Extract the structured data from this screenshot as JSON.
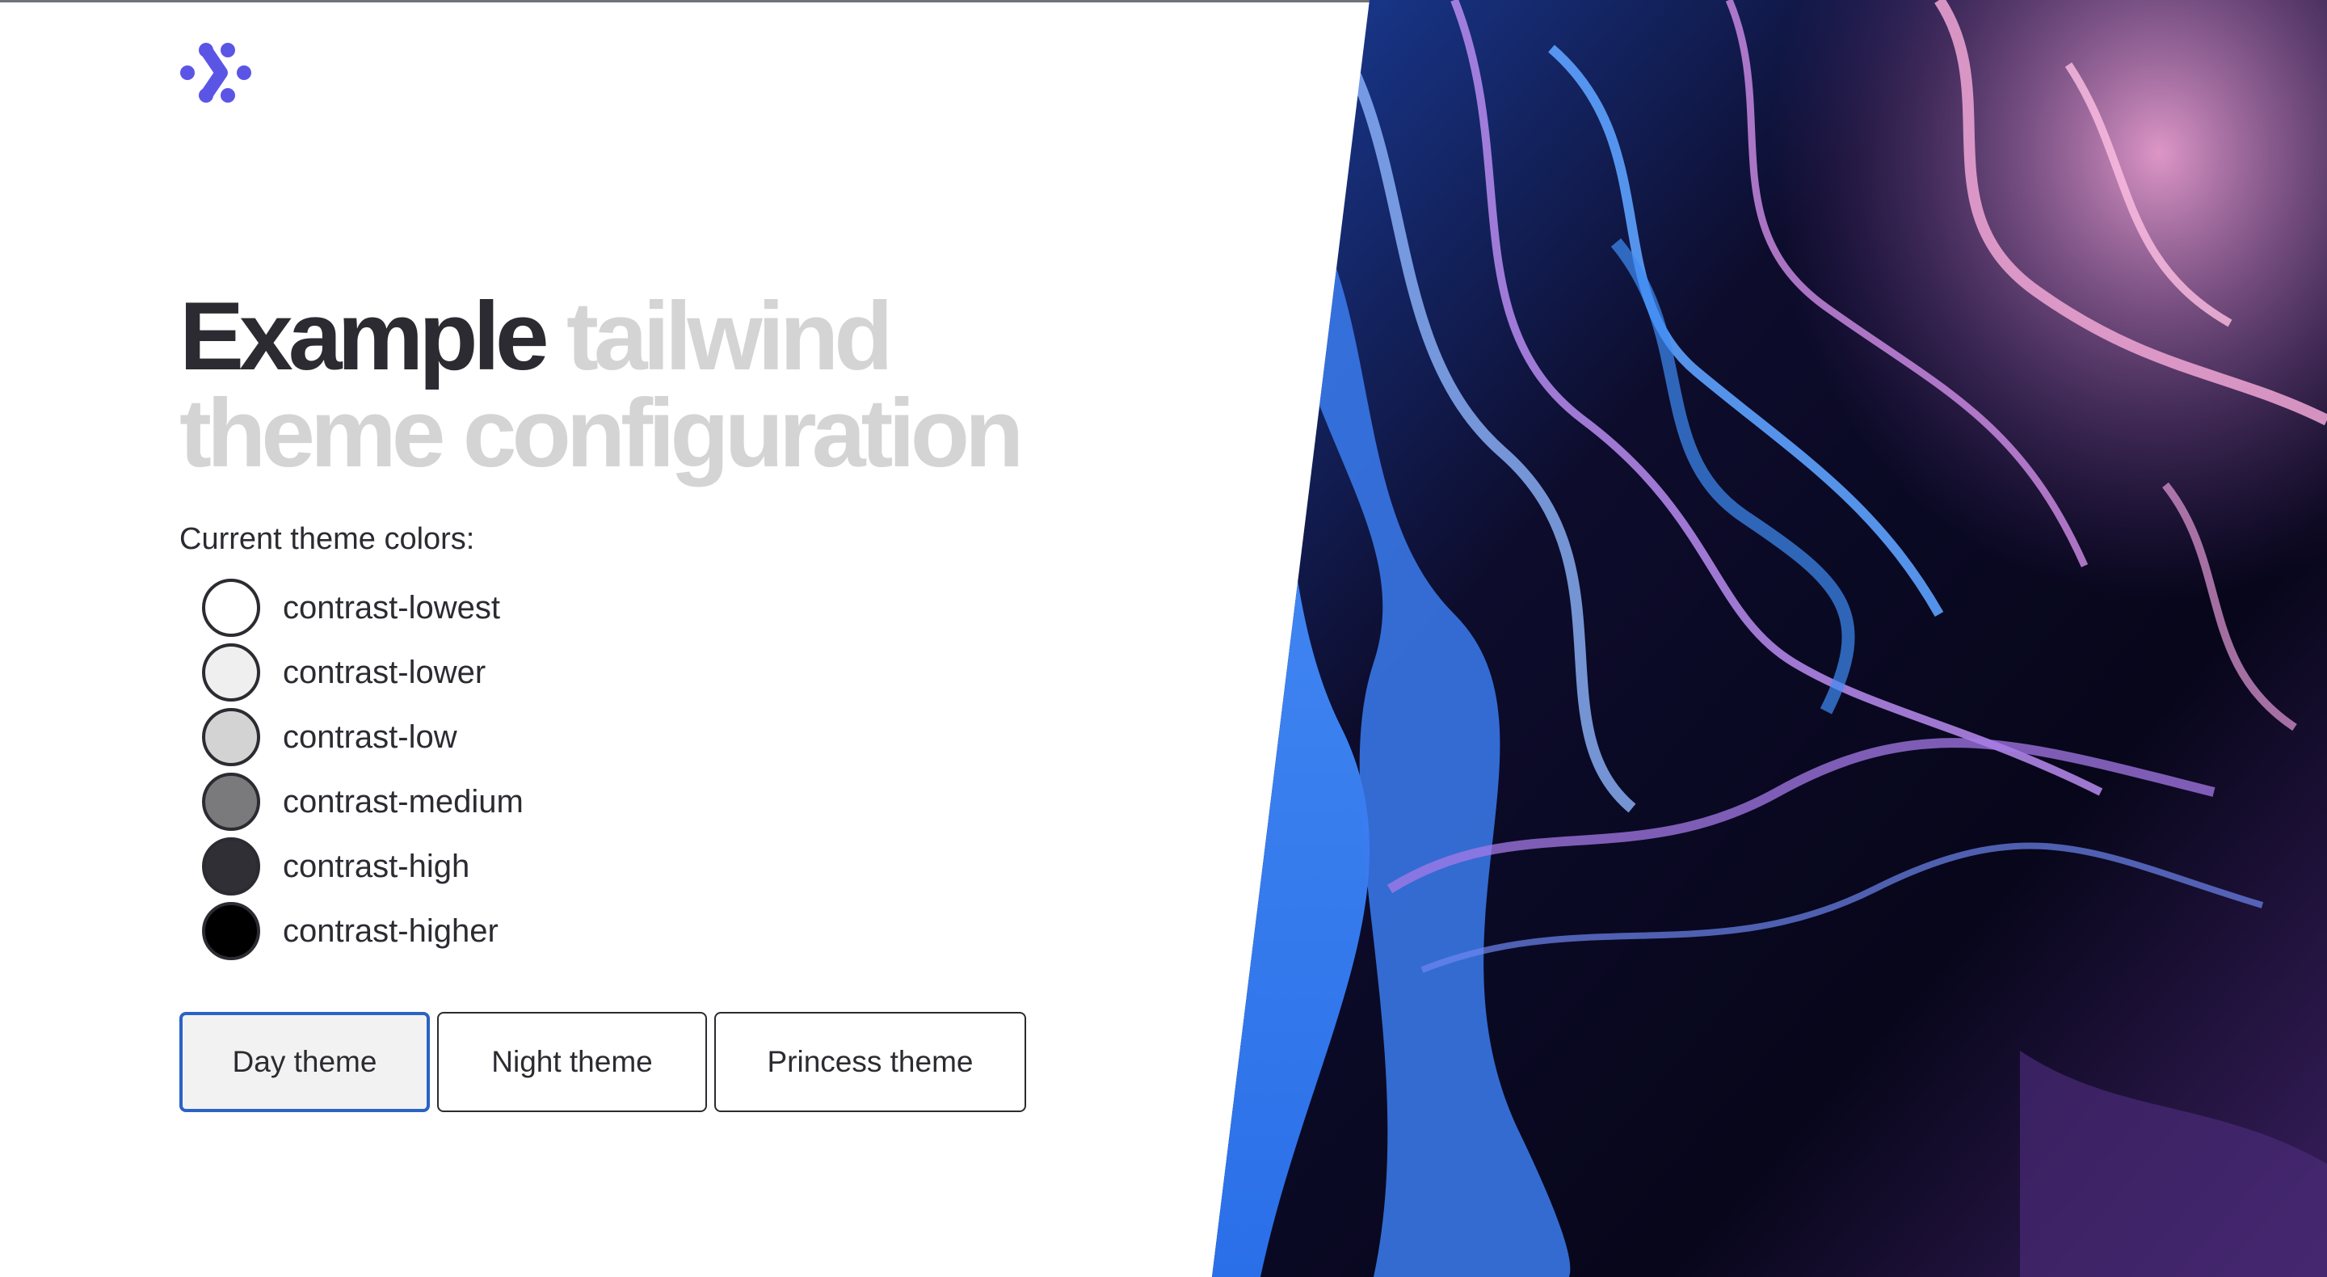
{
  "brand": {
    "logo_icon": "dots-chevron-logo-icon",
    "accent": "#5b55e6"
  },
  "headline": {
    "strong": "Example",
    "soft_line1": "tailwind",
    "soft_line2": "theme configuration"
  },
  "colors_label": "Current theme colors:",
  "theme_colors": [
    {
      "name": "contrast-lowest",
      "color": "#ffffff"
    },
    {
      "name": "contrast-lower",
      "color": "#efefef"
    },
    {
      "name": "contrast-low",
      "color": "#d3d3d3"
    },
    {
      "name": "contrast-medium",
      "color": "#7a7a7c"
    },
    {
      "name": "contrast-high",
      "color": "#2f2f35"
    },
    {
      "name": "contrast-higher",
      "color": "#000000"
    }
  ],
  "buttons": {
    "day": "Day theme",
    "night": "Night theme",
    "princess": "Princess theme",
    "active": "day",
    "active_border": "#2a63c4"
  },
  "hero": {
    "description_icon": "abstract-fluid-art-image"
  }
}
